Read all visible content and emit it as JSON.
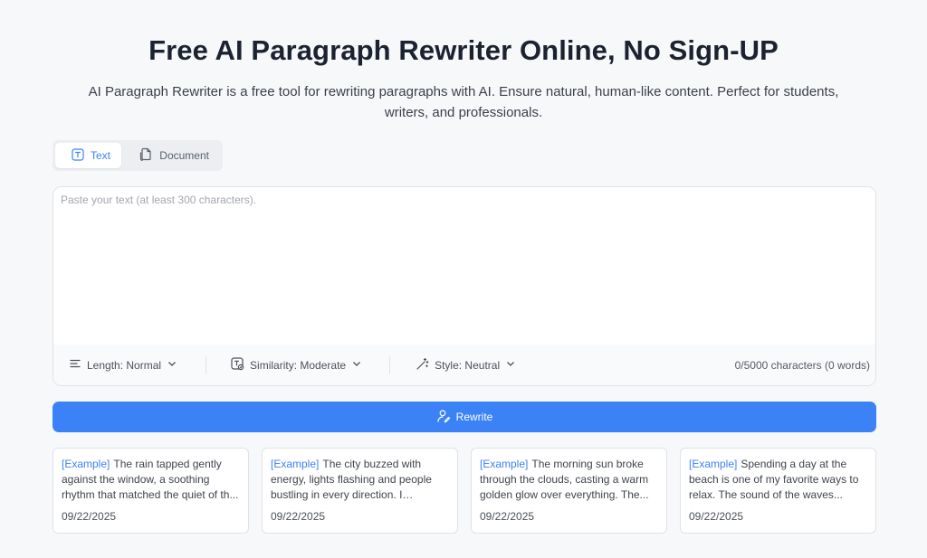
{
  "header": {
    "title": "Free AI Paragraph Rewriter Online, No Sign-UP",
    "subtitle": "AI Paragraph Rewriter is a free tool for rewriting paragraphs with AI. Ensure natural, human-like content. Perfect for students, writers, and professionals."
  },
  "tabs": [
    {
      "label": "Text",
      "icon": "text-icon",
      "active": true
    },
    {
      "label": "Document",
      "icon": "document-icon",
      "active": false
    }
  ],
  "editor": {
    "placeholder": "Paste your text (at least 300 characters).",
    "value": ""
  },
  "toolbar": {
    "length_label": "Length: Normal",
    "similarity_label": "Similarity: Moderate",
    "style_label": "Style: Neutral",
    "char_count": "0/5000 characters (0 words)"
  },
  "rewrite_button": {
    "label": "Rewrite"
  },
  "examples": [
    {
      "tag": "[Example]",
      "text": "The rain tapped gently against the window, a soothing rhythm that matched the quiet of th...",
      "date": "09/22/2025"
    },
    {
      "tag": "[Example]",
      "text": "The city buzzed with energy, lights flashing and people bustling in every direction. I weaved...",
      "date": "09/22/2025"
    },
    {
      "tag": "[Example]",
      "text": "The morning sun broke through the clouds, casting a warm golden glow over everything. The...",
      "date": "09/22/2025"
    },
    {
      "tag": "[Example]",
      "text": "Spending a day at the beach is one of my favorite ways to relax. The sound of the waves...",
      "date": "09/22/2025"
    }
  ],
  "colors": {
    "accent": "#3b82f6",
    "background": "#f7f8fa",
    "border": "#dfe2e7"
  }
}
